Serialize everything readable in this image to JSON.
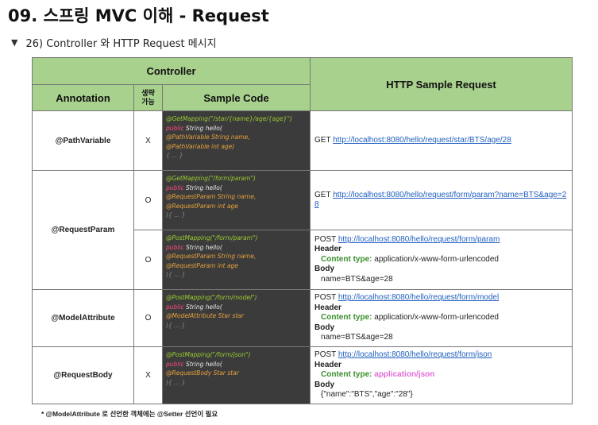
{
  "page_title": "09. 스프링 MVC 이해 - Request",
  "section": {
    "toggle_icon": "▼",
    "label": "26) Controller 와 HTTP Request 메시지"
  },
  "table": {
    "header_controller": "Controller",
    "header_http": "HTTP Sample Request",
    "col_annotation": "Annotation",
    "col_omit_line1": "생략",
    "col_omit_line2": "가능",
    "col_sample_code": "Sample Code",
    "rows": [
      {
        "annotation": "@PathVariable",
        "omittable": "X",
        "code": [
          "@GetMapping(\"/star/{name}/age/{age}\")",
          "public String hello(",
          "  @PathVariable String name,",
          "  @PathVariable int age)",
          "{ ... }"
        ],
        "request": {
          "method": "GET",
          "url": "http://localhost:8080/hello/request/star/BTS/age/28"
        }
      },
      {
        "annotation": "@RequestParam",
        "omittable": "O",
        "code": [
          "@GetMapping(\"/form/param\")",
          "public String hello(",
          "  @RequestParam String name,",
          "  @RequestParam int age",
          "){ ... }"
        ],
        "request": {
          "method": "GET",
          "url": "http://localhost:8080/hello/request/form/param?name=BTS&age=28"
        }
      },
      {
        "annotation": "",
        "omittable": "O",
        "code": [
          "@PostMapping(\"/form/param\")",
          "public String hello(",
          "  @RequestParam String name,",
          "  @RequestParam int age",
          "){ ... }"
        ],
        "request": {
          "method": "POST",
          "url": "http://localhost:8080/hello/request/form/param",
          "header_label": "Header",
          "content_type_label": "Content type:",
          "content_type_value": "application/x-www-form-urlencoded",
          "body_label": "Body",
          "body_value": "name=BTS&age=28"
        }
      },
      {
        "annotation": "@ModelAttribute",
        "omittable": "O",
        "code": [
          "@PostMapping(\"/form/model\")",
          "public String hello(",
          "  @ModelAttribute Star star",
          "){ ... }"
        ],
        "request": {
          "method": "POST",
          "url": "http://localhost:8080/hello/request/form/model",
          "header_label": "Header",
          "content_type_label": "Content type:",
          "content_type_value": "application/x-www-form-urlencoded",
          "body_label": "Body",
          "body_value": "name=BTS&age=28"
        }
      },
      {
        "annotation": "@RequestBody",
        "omittable": "X",
        "code": [
          "@PostMapping(\"/form/json\")",
          "public String hello(",
          "  @RequestBody Star star",
          "){ ... }"
        ],
        "request": {
          "method": "POST",
          "url": "http://localhost:8080/hello/request/form/json",
          "header_label": "Header",
          "content_type_label": "Content type:",
          "content_type_value": "application/json",
          "body_label": "Body",
          "body_value": "{\"name\":\"BTS\",\"age\":\"28\"}"
        }
      }
    ]
  },
  "footnote": "* @ModelAttribute 로 선언한 객체에는 @Setter 선언이 필요",
  "colors": {
    "header_green": "#a9d18e",
    "code_bg": "#3b3b3b",
    "link_blue": "#1f5fbf",
    "content_type_green": "#3a8f2c",
    "json_pink": "#e26bd8"
  }
}
